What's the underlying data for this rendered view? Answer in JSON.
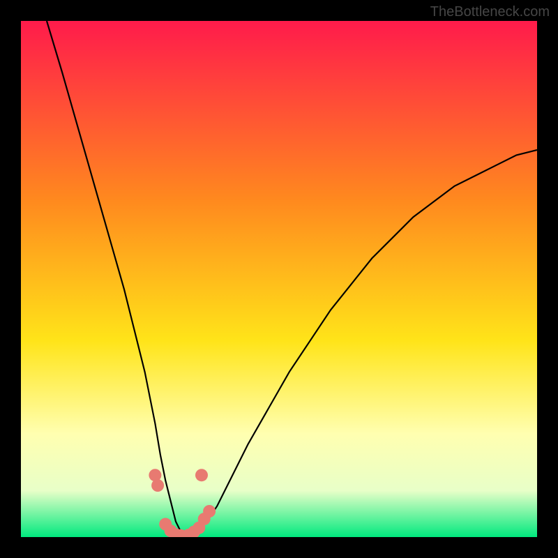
{
  "watermark": "TheBottleneck.com",
  "colors": {
    "background": "#000000",
    "gradient_top": "#ff1b4b",
    "gradient_mid1": "#ff8a1e",
    "gradient_mid2": "#ffe419",
    "gradient_mid3": "#ffffb0",
    "gradient_mid4": "#e8ffc8",
    "gradient_bottom": "#00e97e",
    "curve": "#000000",
    "markers": "#e87a71"
  },
  "chart_data": {
    "type": "line",
    "title": "",
    "xlabel": "",
    "ylabel": "",
    "xlim": [
      0,
      100
    ],
    "ylim": [
      0,
      100
    ],
    "series": [
      {
        "name": "bottleneck-curve",
        "x": [
          5,
          8,
          10,
          12,
          14,
          16,
          18,
          20,
          22,
          24,
          26,
          27,
          28,
          29,
          30,
          31,
          32,
          33,
          34,
          36,
          38,
          40,
          44,
          48,
          52,
          56,
          60,
          64,
          68,
          72,
          76,
          80,
          84,
          88,
          92,
          96,
          100
        ],
        "y": [
          100,
          90,
          83,
          76,
          69,
          62,
          55,
          48,
          40,
          32,
          22,
          16,
          11,
          7,
          3,
          1,
          0,
          0,
          1,
          3,
          6,
          10,
          18,
          25,
          32,
          38,
          44,
          49,
          54,
          58,
          62,
          65,
          68,
          70,
          72,
          74,
          75
        ]
      }
    ],
    "markers": {
      "name": "highlight-points",
      "x": [
        26,
        26.5,
        28,
        29,
        30,
        31,
        32.5,
        33.5,
        34.5,
        35.5,
        35,
        36.5
      ],
      "y": [
        12,
        10,
        2.5,
        1.2,
        0.5,
        0.3,
        0.4,
        1,
        1.8,
        3.5,
        12,
        5
      ]
    }
  }
}
